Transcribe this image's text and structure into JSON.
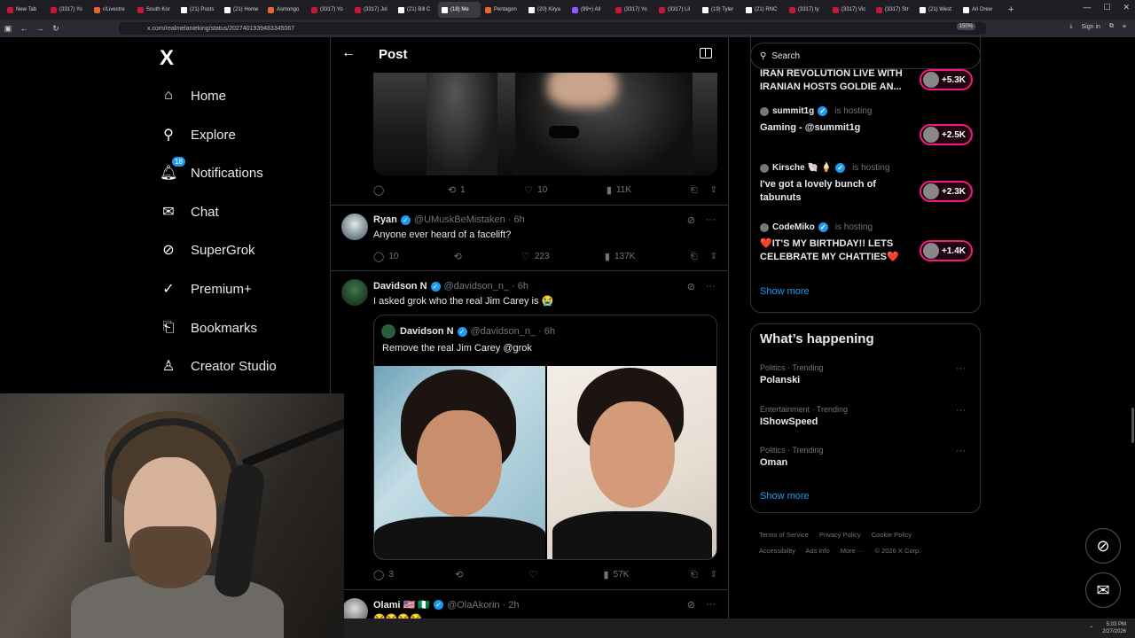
{
  "browser": {
    "tabs": [
      {
        "label": "New Tab",
        "fav": ""
      },
      {
        "label": "(3317) Yo",
        "fav": ""
      },
      {
        "label": "r/Livestre",
        "fav": "o"
      },
      {
        "label": "South Kor",
        "fav": ""
      },
      {
        "label": "(21) Posts",
        "fav": "x"
      },
      {
        "label": "(21) Home",
        "fav": "x"
      },
      {
        "label": "Asmongo",
        "fav": "o"
      },
      {
        "label": "(3317) Yo",
        "fav": ""
      },
      {
        "label": "(3317) Jol",
        "fav": ""
      },
      {
        "label": "(21) Bill C",
        "fav": "x"
      },
      {
        "label": "(18) Me",
        "fav": "x",
        "active": true
      },
      {
        "label": "Pentagon",
        "fav": "o"
      },
      {
        "label": "(20) Kirya",
        "fav": "x"
      },
      {
        "label": "(99+) All",
        "fav": "g"
      },
      {
        "label": "(3317) Yo",
        "fav": ""
      },
      {
        "label": "(3317) Lil",
        "fav": ""
      },
      {
        "label": "(19) Tyler",
        "fav": "x"
      },
      {
        "label": "(21) RNC",
        "fav": "x"
      },
      {
        "label": "(3317) ty",
        "fav": ""
      },
      {
        "label": "(3317) Vic",
        "fav": ""
      },
      {
        "label": "(3317) Str",
        "fav": ""
      },
      {
        "label": "(21) West",
        "fav": "x"
      },
      {
        "label": "Ari Drew",
        "fav": "x"
      }
    ],
    "url": "x.com/realmelanieking/status/2027401939483345067",
    "zoom": "150%",
    "signin": "Sign in"
  },
  "nav": {
    "logo": "X",
    "items": [
      {
        "label": "Home",
        "icon": "⌂",
        "name": "home"
      },
      {
        "label": "Explore",
        "icon": "⚲",
        "name": "explore"
      },
      {
        "label": "Notifications",
        "icon": "🔔︎",
        "name": "notifications",
        "badge": "18"
      },
      {
        "label": "Chat",
        "icon": "✉",
        "name": "chat"
      },
      {
        "label": "SuperGrok",
        "icon": "⊘",
        "name": "supergrok"
      },
      {
        "label": "Premium+",
        "icon": "✓",
        "name": "premium"
      },
      {
        "label": "Bookmarks",
        "icon": "⎗",
        "name": "bookmarks"
      },
      {
        "label": "Creator Studio",
        "icon": "♙",
        "name": "creator-studio"
      }
    ]
  },
  "main": {
    "title": "Post",
    "top_post_actions": {
      "replies": "",
      "reposts": "1",
      "likes": "10",
      "views": "11K"
    },
    "posts": [
      {
        "name": "Ryan",
        "handle": "@UMuskBeMistaken",
        "time": "· 6h",
        "text": "Anyone ever heard of a facelift?",
        "replies": "10",
        "reposts": "",
        "likes": "223",
        "views": "137K"
      },
      {
        "name": "Davidson N",
        "handle": "@davidson_n_",
        "time": "· 6h",
        "text": "I asked grok who the real Jim Carey is 😭",
        "quote": {
          "name": "Davidson N",
          "handle": "@davidson_n_",
          "time": "· 6h",
          "text": "Remove the real Jim Carey @grok"
        },
        "replies": "3",
        "reposts": "",
        "likes": "",
        "views": "57K"
      },
      {
        "name": "Olami 🇺🇸 🇳🇬",
        "handle": "@OlaAkorin",
        "time": "· 2h",
        "text": "😂😂😂😂"
      }
    ]
  },
  "right": {
    "search_placeholder": "Search",
    "live": [
      {
        "host": "",
        "title": "IRAN REVOLUTION LIVE WITH IRANIAN HOSTS GOLDIE AN...",
        "count": "+5.3K"
      },
      {
        "host": "summit1g",
        "hosting": "is hosting",
        "title": "Gaming - @summit1g",
        "count": "+2.5K"
      },
      {
        "host": "Kirsche 🐚 🍦",
        "hosting": "is hosting",
        "title": "I've got a lovely bunch of tabunuts",
        "count": "+2.3K"
      },
      {
        "host": "CodeMiko",
        "hosting": "is hosting",
        "title": "❤️IT'S MY BIRTHDAY!! LETS CELEBRATE MY CHATTIES❤️",
        "count": "+1.4K"
      }
    ],
    "live_show_more": "Show more",
    "happening_title": "What’s happening",
    "trends": [
      {
        "category": "Politics · Trending",
        "name": "Polanski"
      },
      {
        "category": "Entertainment · Trending",
        "name": "IShowSpeed"
      },
      {
        "category": "Politics · Trending",
        "name": "Oman"
      }
    ],
    "trends_show_more": "Show more",
    "footer": [
      "Terms of Service",
      "Privacy Policy",
      "Cookie Policy",
      "Accessibility",
      "Ads info",
      "More ···",
      "© 2026 X Corp."
    ]
  },
  "taskbar": {
    "time": "5:03 PM",
    "date": "2/27/2026"
  }
}
